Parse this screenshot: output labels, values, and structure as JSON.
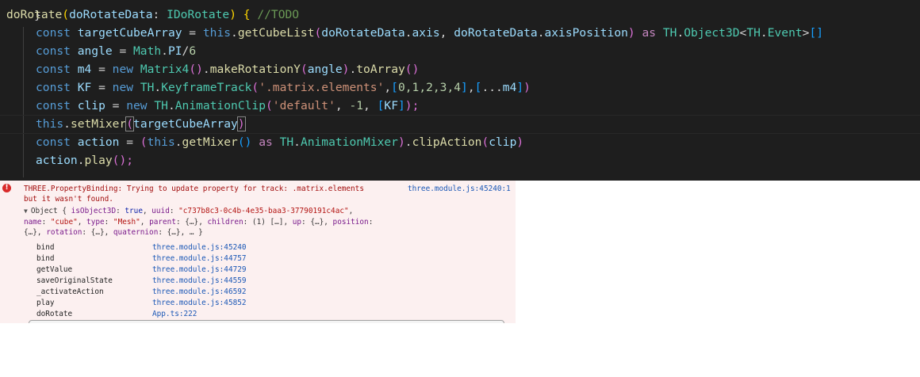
{
  "editor": {
    "top_fragment": "}",
    "line1": {
      "fn": "doRotate",
      "open": "(",
      "param": "doRotateData",
      "colon": ": ",
      "type": "IDoRotate",
      "close": ")",
      "brace": " { ",
      "comment": "//TODO"
    },
    "line2": {
      "kw": "const ",
      "name": "targetCubeArray",
      "eq": " = ",
      "this": "this",
      "dot": ".",
      "fn": "getCubeList",
      "p1": "(",
      "a1": "doRotateData",
      "d1": ".",
      "a2": "axis",
      "comma": ", ",
      "a3": "doRotateData",
      "d2": ".",
      "a4": "axisPosition",
      "p2": ")",
      "as": " as ",
      "ns": "TH",
      "d3": ".",
      "cls": "Object3D",
      "lt": "<",
      "ns2": "TH",
      "d4": ".",
      "cls2": "Event",
      "gt": ">",
      "arr": "[]"
    },
    "line3": {
      "kw": "const ",
      "name": "angle",
      "eq": " = ",
      "obj": "Math",
      "dot": ".",
      "prop": "PI",
      "div": "/",
      "num": "6"
    },
    "line4": {
      "kw": "const ",
      "name": "m4",
      "eq": " = ",
      "new": "new ",
      "cls": "Matrix4",
      "p1": "()",
      "dot": ".",
      "fn": "makeRotationY",
      "p2": "(",
      "arg": "angle",
      "p3": ")",
      "dot2": ".",
      "fn2": "toArray",
      "p4": "()"
    },
    "line5": {
      "kw": "const ",
      "name": "KF",
      "eq": " = ",
      "new": "new ",
      "ns": "TH",
      "dot": ".",
      "cls": "KeyframeTrack",
      "p1": "(",
      "str": "'.matrix.elements'",
      "c1": ",",
      "b1": "[",
      "nums": "0,1,2,3,4",
      "b2": "]",
      "c2": ",",
      "b3": "[",
      "spread": "...",
      "arg": "m4",
      "b4": "]",
      "p2": ")"
    },
    "line6": {
      "kw": "const ",
      "name": "clip",
      "eq": " = ",
      "new": "new ",
      "ns": "TH",
      "dot": ".",
      "cls": "AnimationClip",
      "p1": "(",
      "str": "'default'",
      "c1": ", ",
      "num": "-1",
      "c2": ", ",
      "b1": "[",
      "arg": "KF",
      "b2": "]",
      "p2": ");"
    },
    "line7": {
      "this": "this",
      "dot": ".",
      "fn": "setMixer",
      "p1": "(",
      "arg": "targetCubeArray",
      "p2": ")"
    },
    "line8": {
      "kw": "const ",
      "name": "action",
      "eq": " = ",
      "p1": "(",
      "this": "this",
      "dot": ".",
      "fn": "getMixer",
      "p2": "()",
      "as": " as ",
      "ns": "TH",
      "dot2": ".",
      "cls": "AnimationMixer",
      "p3": ")",
      "dot3": ".",
      "fn2": "clipAction",
      "p4": "(",
      "arg": "clip",
      "p5": ")"
    },
    "line9": {
      "name": "action",
      "dot": ".",
      "fn": "play",
      "p": "();"
    }
  },
  "console": {
    "error_icon": "!",
    "error_line1": "THREE.PropertyBinding: Trying to update property for track: .matrix.elements",
    "error_line2": "but it wasn't found.",
    "source_link": "three.module.js:45240:1",
    "object": {
      "triangle": "▼",
      "l1_a": "Object { ",
      "l1_k1": "isObject3D",
      "l1_c1": ": ",
      "l1_v1": "true",
      "l1_c2": ", ",
      "l1_k2": "uuid",
      "l1_c3": ": ",
      "l1_v2": "\"c737b8c3-0c4b-4e35-baa3-37790191c4ac\"",
      "l1_e": ",",
      "l2_k1": "name",
      "l2_c1": ": ",
      "l2_v1": "\"cube\"",
      "l2_c2": ", ",
      "l2_k2": "type",
      "l2_c3": ": ",
      "l2_v2": "\"Mesh\"",
      "l2_c4": ", ",
      "l2_k3": "parent",
      "l2_r": ": {…}, ",
      "l2_k4": "children",
      "l2_r2": ": (1) […], ",
      "l2_k5": "up",
      "l2_r3": ": {…}, ",
      "l2_k6": "position",
      "l2_r4": ":",
      "l3_a": "{…}, ",
      "l3_k1": "rotation",
      "l3_r1": ": {…}, ",
      "l3_k2": "quaternion",
      "l3_r2": ": {…}, … }"
    },
    "stack": [
      {
        "fn": "bind",
        "loc": "three.module.js:45240"
      },
      {
        "fn": "bind",
        "loc": "three.module.js:44757"
      },
      {
        "fn": "getValue",
        "loc": "three.module.js:44729"
      },
      {
        "fn": "saveOriginalState",
        "loc": "three.module.js:44559"
      },
      {
        "fn": "_activateAction",
        "loc": "three.module.js:46592"
      },
      {
        "fn": "play",
        "loc": "three.module.js:45852"
      },
      {
        "fn": "doRotate",
        "loc": "App.ts:222"
      }
    ]
  }
}
